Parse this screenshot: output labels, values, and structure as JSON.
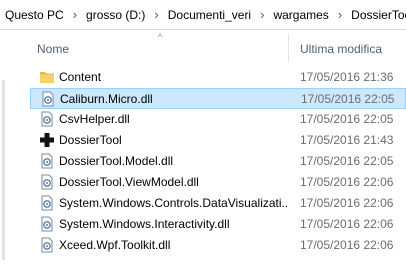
{
  "address": {
    "crumbs": [
      "Questo PC",
      "grosso (D:)",
      "Documenti_veri",
      "wargames",
      "DossierTool"
    ]
  },
  "columns": {
    "name": "Nome",
    "date": "Ultima modifica"
  },
  "files": [
    {
      "name": "Content",
      "date": "17/05/2016 21:36",
      "icon": "folder-icon",
      "selected": false
    },
    {
      "name": "Caliburn.Micro.dll",
      "date": "17/05/2016 22:05",
      "icon": "dll-file-icon",
      "selected": true
    },
    {
      "name": "CsvHelper.dll",
      "date": "17/05/2016 22:05",
      "icon": "dll-file-icon",
      "selected": false
    },
    {
      "name": "DossierTool",
      "date": "17/05/2016 21:43",
      "icon": "app-cross-icon",
      "selected": false
    },
    {
      "name": "DossierTool.Model.dll",
      "date": "17/05/2016 22:05",
      "icon": "dll-file-icon",
      "selected": false
    },
    {
      "name": "DossierTool.ViewModel.dll",
      "date": "17/05/2016 22:06",
      "icon": "dll-file-icon",
      "selected": false
    },
    {
      "name": "System.Windows.Controls.DataVisualizati...",
      "date": "17/05/2016 22:06",
      "icon": "dll-file-icon",
      "selected": false
    },
    {
      "name": "System.Windows.Interactivity.dll",
      "date": "17/05/2016 22:06",
      "icon": "dll-file-icon",
      "selected": false
    },
    {
      "name": "Xceed.Wpf.Toolkit.dll",
      "date": "17/05/2016 22:06",
      "icon": "dll-file-icon",
      "selected": false
    }
  ],
  "colors": {
    "selection": "#cce8ff",
    "selection_border": "#99d1ff",
    "folder": "#f5d36b"
  }
}
